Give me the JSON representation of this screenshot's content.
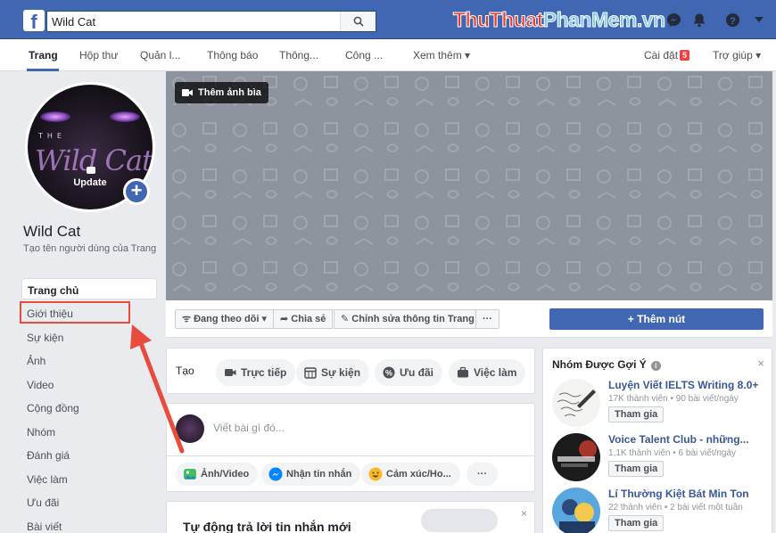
{
  "topbar": {
    "logo_letter": "f",
    "search_value": "Wild Cat",
    "brand_part1": "ThuThuat",
    "brand_part2": "PhanMem.vn",
    "icons": [
      "messenger-icon",
      "notifications-icon",
      "help-icon",
      "dropdown-caret-icon"
    ]
  },
  "tabs": [
    {
      "label": "Trang"
    },
    {
      "label": "Hộp thư"
    },
    {
      "label": "Quản l..."
    },
    {
      "label": "Thông báo"
    },
    {
      "label": "Thông..."
    },
    {
      "label": "Công ..."
    },
    {
      "label": "Xem thêm ▾"
    }
  ],
  "settings": {
    "label": "Cài đặt",
    "badge": "5"
  },
  "help": {
    "label": "Trợ giúp ▾"
  },
  "profile": {
    "avatar_text_the": "THE",
    "avatar_script": "Wild Cat",
    "update_label": "Update",
    "name": "Wild Cat",
    "handle_prompt": "Tạo tên người dùng của Trang"
  },
  "left_menu": [
    {
      "label": "Trang chủ"
    },
    {
      "label": "Giới thiệu"
    },
    {
      "label": "Sự kiện"
    },
    {
      "label": "Ảnh"
    },
    {
      "label": "Video"
    },
    {
      "label": "Cộng đồng"
    },
    {
      "label": "Nhóm"
    },
    {
      "label": "Đánh giá"
    },
    {
      "label": "Việc làm"
    },
    {
      "label": "Ưu đãi"
    },
    {
      "label": "Bài viết"
    }
  ],
  "cover": {
    "add_cover_label": "Thêm ảnh bìa"
  },
  "actions": {
    "following": "Đang theo dõi ▾",
    "share": "Chia sẻ",
    "edit_info": "Chỉnh sửa thông tin Trang",
    "more": "···",
    "add_button": "+ Thêm nút"
  },
  "composer_tabs": {
    "label": "Tạo",
    "items": [
      {
        "label": "Trực tiếp"
      },
      {
        "label": "Sự kiện"
      },
      {
        "label": "Ưu đãi"
      },
      {
        "label": "Việc làm"
      }
    ]
  },
  "composer": {
    "placeholder": "Viết bài gì đó...",
    "items": [
      {
        "label": "Ảnh/Video"
      },
      {
        "label": "Nhận tin nhắn"
      },
      {
        "label": "Cảm xúc/Ho..."
      },
      {
        "label": "···"
      }
    ]
  },
  "auto_reply": {
    "title": "Tự động trả lời tin nhắn mới",
    "close": "×"
  },
  "groups": {
    "title": "Nhóm Được Gợi Ý",
    "close": "×",
    "items": [
      {
        "name": "Luyện Viết IELTS Writing 8.0+",
        "meta": "17K thành viên • 90 bài viết/ngày",
        "join": "Tham gia"
      },
      {
        "name": "Voice Talent Club - những...",
        "meta": "1,1K thành viên • 6 bài viết/ngày",
        "join": "Tham gia"
      },
      {
        "name": "Lí Thường Kiệt Bát Min Ton",
        "meta": "22 thành viên • 2 bài viết một tuần",
        "join": "Tham gia"
      }
    ]
  },
  "colors": {
    "facebook_blue": "#4267b2",
    "highlight_red": "#e74c3c",
    "link_blue": "#385898"
  }
}
